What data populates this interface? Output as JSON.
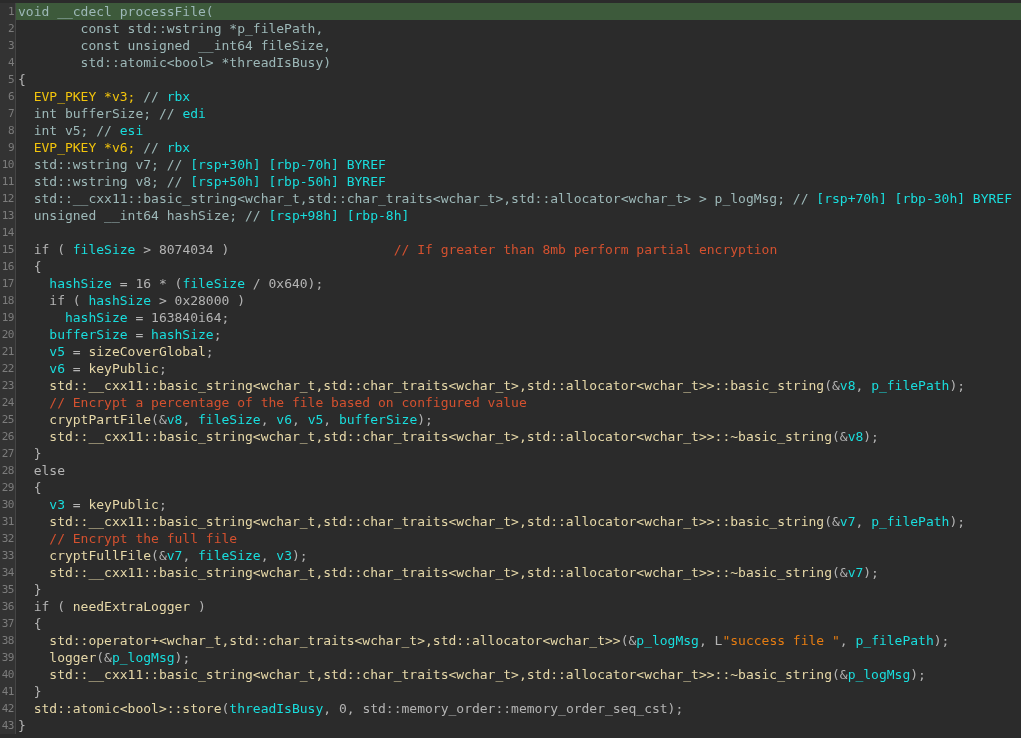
{
  "editor": {
    "lines": [
      {
        "number": "1",
        "selected": true,
        "tokens": [
          {
            "text": "void __cdecl processFile(",
            "kind": "decl"
          }
        ]
      },
      {
        "number": "2",
        "selected": false,
        "tokens": [
          {
            "text": "        const std::wstring *p_filePath,",
            "kind": "decl"
          }
        ]
      },
      {
        "number": "3",
        "selected": false,
        "tokens": [
          {
            "text": "        const unsigned __int64 fileSize,",
            "kind": "decl"
          }
        ]
      },
      {
        "number": "4",
        "selected": false,
        "tokens": [
          {
            "text": "        std::atomic<bool> *threadIsBusy)",
            "kind": "decl"
          }
        ]
      },
      {
        "number": "5",
        "selected": false,
        "tokens": [
          {
            "text": "{",
            "kind": "plain"
          }
        ]
      },
      {
        "number": "6",
        "selected": false,
        "tokens": [
          {
            "text": "  EVP_PKEY *v3; ",
            "kind": "type"
          },
          {
            "text": "// ",
            "kind": "decl"
          },
          {
            "text": "rbx",
            "kind": "var"
          }
        ]
      },
      {
        "number": "7",
        "selected": false,
        "tokens": [
          {
            "text": "  int bufferSize; // ",
            "kind": "decl"
          },
          {
            "text": "edi",
            "kind": "var"
          }
        ]
      },
      {
        "number": "8",
        "selected": false,
        "tokens": [
          {
            "text": "  int v5; // ",
            "kind": "decl"
          },
          {
            "text": "esi",
            "kind": "var"
          }
        ]
      },
      {
        "number": "9",
        "selected": false,
        "tokens": [
          {
            "text": "  EVP_PKEY *v6; ",
            "kind": "type"
          },
          {
            "text": "// ",
            "kind": "decl"
          },
          {
            "text": "rbx",
            "kind": "var"
          }
        ]
      },
      {
        "number": "10",
        "selected": false,
        "tokens": [
          {
            "text": "  std::wstring v7; // ",
            "kind": "decl"
          },
          {
            "text": "[rsp+30h] [rbp-70h] BYREF",
            "kind": "var"
          }
        ]
      },
      {
        "number": "11",
        "selected": false,
        "tokens": [
          {
            "text": "  std::wstring v8; // ",
            "kind": "decl"
          },
          {
            "text": "[rsp+50h] [rbp-50h] BYREF",
            "kind": "var"
          }
        ]
      },
      {
        "number": "12",
        "selected": false,
        "tokens": [
          {
            "text": "  std::__cxx11::basic_string<wchar_t,std::char_traits<wchar_t>,std::allocator<wchar_t> > p_logMsg; // ",
            "kind": "decl"
          },
          {
            "text": "[rsp+70h] [rbp-30h] BYREF",
            "kind": "var"
          }
        ]
      },
      {
        "number": "13",
        "selected": false,
        "tokens": [
          {
            "text": "  unsigned __int64 hashSize; // ",
            "kind": "decl"
          },
          {
            "text": "[rsp+98h] [rbp-8h]",
            "kind": "var"
          }
        ]
      },
      {
        "number": "14",
        "selected": false
      },
      {
        "number": "15",
        "selected": false,
        "tokens": [
          {
            "text": "  if ( ",
            "kind": "plain"
          },
          {
            "text": "fileSize",
            "kind": "var"
          },
          {
            "text": " > 8074034 )                     ",
            "kind": "plain"
          },
          {
            "text": "// If greater than 8mb perform partial encryption",
            "kind": "comment"
          }
        ]
      },
      {
        "number": "16",
        "selected": false,
        "tokens": [
          {
            "text": "  {",
            "kind": "plain"
          }
        ]
      },
      {
        "number": "17",
        "selected": false,
        "tokens": [
          {
            "text": "    hashSize",
            "kind": "var"
          },
          {
            "text": " = 16 * (",
            "kind": "plain"
          },
          {
            "text": "fileSize",
            "kind": "var"
          },
          {
            "text": " / 0x640);",
            "kind": "plain"
          }
        ]
      },
      {
        "number": "18",
        "selected": false,
        "tokens": [
          {
            "text": "    if ( ",
            "kind": "plain"
          },
          {
            "text": "hashSize",
            "kind": "var"
          },
          {
            "text": " > 0x28000 )",
            "kind": "plain"
          }
        ]
      },
      {
        "number": "19",
        "selected": false,
        "tokens": [
          {
            "text": "      hashSize",
            "kind": "var"
          },
          {
            "text": " = 163840i64;",
            "kind": "plain"
          }
        ]
      },
      {
        "number": "20",
        "selected": false,
        "tokens": [
          {
            "text": "    bufferSize",
            "kind": "var"
          },
          {
            "text": " = ",
            "kind": "plain"
          },
          {
            "text": "hashSize",
            "kind": "var"
          },
          {
            "text": ";",
            "kind": "plain"
          }
        ]
      },
      {
        "number": "21",
        "selected": false,
        "tokens": [
          {
            "text": "    v5",
            "kind": "var"
          },
          {
            "text": " = ",
            "kind": "plain"
          },
          {
            "text": "sizeCoverGlobal",
            "kind": "name"
          },
          {
            "text": ";",
            "kind": "plain"
          }
        ]
      },
      {
        "number": "22",
        "selected": false,
        "tokens": [
          {
            "text": "    v6",
            "kind": "var"
          },
          {
            "text": " = ",
            "kind": "plain"
          },
          {
            "text": "keyPublic",
            "kind": "name"
          },
          {
            "text": ";",
            "kind": "plain"
          }
        ]
      },
      {
        "number": "23",
        "selected": false,
        "tokens": [
          {
            "text": "    std::__cxx11::basic_string<wchar_t,std::char_traits<wchar_t>,std::allocator<wchar_t>>::basic_string",
            "kind": "name"
          },
          {
            "text": "(&",
            "kind": "plain"
          },
          {
            "text": "v8",
            "kind": "var"
          },
          {
            "text": ", ",
            "kind": "plain"
          },
          {
            "text": "p_filePath",
            "kind": "var"
          },
          {
            "text": ");",
            "kind": "plain"
          }
        ]
      },
      {
        "number": "24",
        "selected": false,
        "tokens": [
          {
            "text": "    // Encrypt a percentage of the file based on configured value",
            "kind": "comment"
          }
        ]
      },
      {
        "number": "25",
        "selected": false,
        "tokens": [
          {
            "text": "    cryptPartFile",
            "kind": "name"
          },
          {
            "text": "(&",
            "kind": "plain"
          },
          {
            "text": "v8",
            "kind": "var"
          },
          {
            "text": ", ",
            "kind": "plain"
          },
          {
            "text": "fileSize",
            "kind": "var"
          },
          {
            "text": ", ",
            "kind": "plain"
          },
          {
            "text": "v6",
            "kind": "var"
          },
          {
            "text": ", ",
            "kind": "plain"
          },
          {
            "text": "v5",
            "kind": "var"
          },
          {
            "text": ", ",
            "kind": "plain"
          },
          {
            "text": "bufferSize",
            "kind": "var"
          },
          {
            "text": ");",
            "kind": "plain"
          }
        ]
      },
      {
        "number": "26",
        "selected": false,
        "tokens": [
          {
            "text": "    std::__cxx11::basic_string<wchar_t,std::char_traits<wchar_t>,std::allocator<wchar_t>>::~basic_string",
            "kind": "name"
          },
          {
            "text": "(&",
            "kind": "plain"
          },
          {
            "text": "v8",
            "kind": "var"
          },
          {
            "text": ");",
            "kind": "plain"
          }
        ]
      },
      {
        "number": "27",
        "selected": false,
        "tokens": [
          {
            "text": "  }",
            "kind": "plain"
          }
        ]
      },
      {
        "number": "28",
        "selected": false,
        "tokens": [
          {
            "text": "  else",
            "kind": "plain"
          }
        ]
      },
      {
        "number": "29",
        "selected": false,
        "tokens": [
          {
            "text": "  {",
            "kind": "plain"
          }
        ]
      },
      {
        "number": "30",
        "selected": false,
        "tokens": [
          {
            "text": "    v3",
            "kind": "var"
          },
          {
            "text": " = ",
            "kind": "plain"
          },
          {
            "text": "keyPublic",
            "kind": "name"
          },
          {
            "text": ";",
            "kind": "plain"
          }
        ]
      },
      {
        "number": "31",
        "selected": false,
        "tokens": [
          {
            "text": "    std::__cxx11::basic_string<wchar_t,std::char_traits<wchar_t>,std::allocator<wchar_t>>::basic_string",
            "kind": "name"
          },
          {
            "text": "(&",
            "kind": "plain"
          },
          {
            "text": "v7",
            "kind": "var"
          },
          {
            "text": ", ",
            "kind": "plain"
          },
          {
            "text": "p_filePath",
            "kind": "var"
          },
          {
            "text": ");",
            "kind": "plain"
          }
        ]
      },
      {
        "number": "32",
        "selected": false,
        "tokens": [
          {
            "text": "    // Encrypt the full file",
            "kind": "comment"
          }
        ]
      },
      {
        "number": "33",
        "selected": false,
        "tokens": [
          {
            "text": "    cryptFullFile",
            "kind": "name"
          },
          {
            "text": "(&",
            "kind": "plain"
          },
          {
            "text": "v7",
            "kind": "var"
          },
          {
            "text": ", ",
            "kind": "plain"
          },
          {
            "text": "fileSize",
            "kind": "var"
          },
          {
            "text": ", ",
            "kind": "plain"
          },
          {
            "text": "v3",
            "kind": "var"
          },
          {
            "text": ");",
            "kind": "plain"
          }
        ]
      },
      {
        "number": "34",
        "selected": false,
        "tokens": [
          {
            "text": "    std::__cxx11::basic_string<wchar_t,std::char_traits<wchar_t>,std::allocator<wchar_t>>::~basic_string",
            "kind": "name"
          },
          {
            "text": "(&",
            "kind": "plain"
          },
          {
            "text": "v7",
            "kind": "var"
          },
          {
            "text": ");",
            "kind": "plain"
          }
        ]
      },
      {
        "number": "35",
        "selected": false,
        "tokens": [
          {
            "text": "  }",
            "kind": "plain"
          }
        ]
      },
      {
        "number": "36",
        "selected": false,
        "tokens": [
          {
            "text": "  if ( ",
            "kind": "plain"
          },
          {
            "text": "needExtraLogger",
            "kind": "name"
          },
          {
            "text": " )",
            "kind": "plain"
          }
        ]
      },
      {
        "number": "37",
        "selected": false,
        "tokens": [
          {
            "text": "  {",
            "kind": "plain"
          }
        ]
      },
      {
        "number": "38",
        "selected": false,
        "tokens": [
          {
            "text": "    std::operator+<wchar_t,std::char_traits<wchar_t>,std::allocator<wchar_t>>",
            "kind": "name"
          },
          {
            "text": "(&",
            "kind": "plain"
          },
          {
            "text": "p_logMsg",
            "kind": "var"
          },
          {
            "text": ", L",
            "kind": "plain"
          },
          {
            "text": "\"success file \"",
            "kind": "string"
          },
          {
            "text": ", ",
            "kind": "plain"
          },
          {
            "text": "p_filePath",
            "kind": "var"
          },
          {
            "text": ");",
            "kind": "plain"
          }
        ]
      },
      {
        "number": "39",
        "selected": false,
        "tokens": [
          {
            "text": "    logger",
            "kind": "name"
          },
          {
            "text": "(&",
            "kind": "plain"
          },
          {
            "text": "p_logMsg",
            "kind": "var"
          },
          {
            "text": ");",
            "kind": "plain"
          }
        ]
      },
      {
        "number": "40",
        "selected": false,
        "tokens": [
          {
            "text": "    std::__cxx11::basic_string<wchar_t,std::char_traits<wchar_t>,std::allocator<wchar_t>>::~basic_string",
            "kind": "name"
          },
          {
            "text": "(&",
            "kind": "plain"
          },
          {
            "text": "p_logMsg",
            "kind": "var"
          },
          {
            "text": ");",
            "kind": "plain"
          }
        ]
      },
      {
        "number": "41",
        "selected": false,
        "tokens": [
          {
            "text": "  }",
            "kind": "plain"
          }
        ]
      },
      {
        "number": "42",
        "selected": false,
        "tokens": [
          {
            "text": "  std::atomic<bool>::store",
            "kind": "name"
          },
          {
            "text": "(",
            "kind": "plain"
          },
          {
            "text": "threadIsBusy",
            "kind": "var"
          },
          {
            "text": ", 0, std::memory_order::memory_order_seq_cst);",
            "kind": "plain"
          }
        ]
      },
      {
        "number": "43",
        "selected": false,
        "tokens": [
          {
            "text": "}",
            "kind": "plain"
          }
        ]
      }
    ]
  }
}
